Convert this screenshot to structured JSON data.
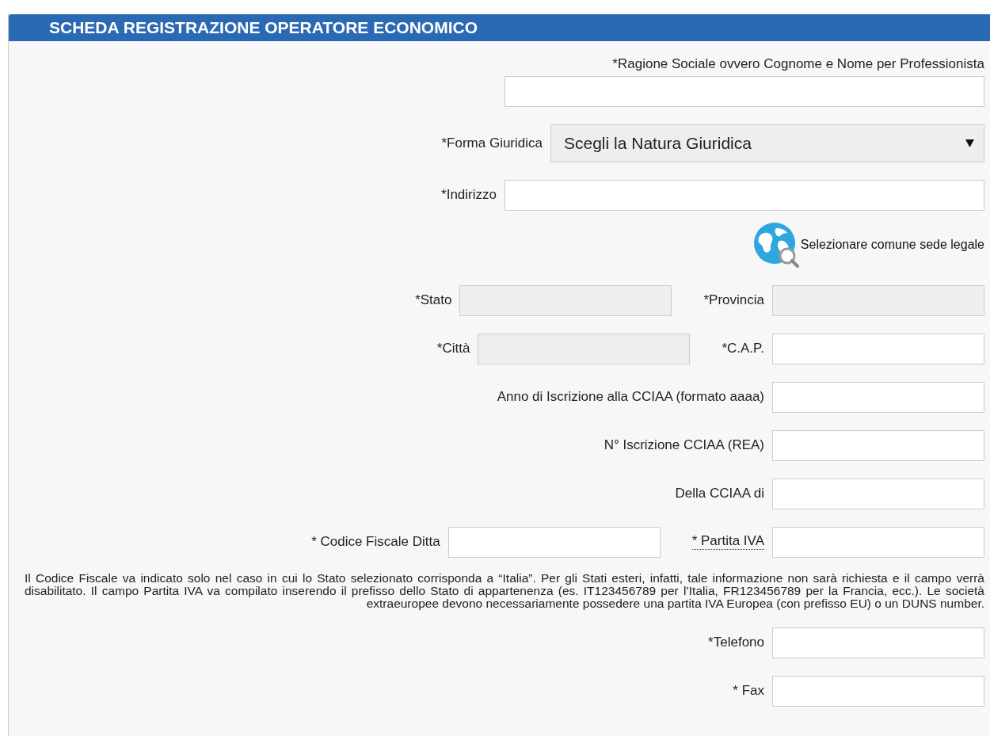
{
  "panel": {
    "title": "SCHEDA REGISTRAZIONE OPERATORE ECONOMICO"
  },
  "rows": [
    {
      "kind": "stacked",
      "fields": [
        {
          "label": "*Ragione Sociale ovvero Cognome e Nome per Professionista",
          "disabled": false
        }
      ]
    },
    {
      "kind": "select",
      "fields": [
        {
          "label": "*Forma Giuridica",
          "value": "Scegli la Natura Giuridica",
          "disabled": false
        }
      ]
    },
    {
      "kind": "wide",
      "fields": [
        {
          "label": "*Indirizzo",
          "disabled": false
        }
      ]
    },
    {
      "kind": "link",
      "text": "Selezionare comune sede legale"
    },
    {
      "kind": "pair",
      "fields": [
        {
          "label": "*Stato",
          "disabled": true
        },
        {
          "label": "*Provincia",
          "disabled": true
        }
      ]
    },
    {
      "kind": "pair",
      "fields": [
        {
          "label": "*Città",
          "disabled": true
        },
        {
          "label": "*C.A.P.",
          "disabled": false
        }
      ]
    },
    {
      "kind": "single",
      "fields": [
        {
          "label": "Anno di Iscrizione alla CCIAA (formato aaaa)",
          "disabled": false
        }
      ]
    },
    {
      "kind": "single",
      "fields": [
        {
          "label": "N° Iscrizione CCIAA (REA)",
          "disabled": false
        }
      ]
    },
    {
      "kind": "single",
      "fields": [
        {
          "label": "Della CCIAA di",
          "disabled": false
        }
      ]
    },
    {
      "kind": "pair",
      "fields": [
        {
          "label": "* Codice Fiscale Ditta",
          "disabled": false
        },
        {
          "label": "* Partita IVA",
          "disabled": false,
          "dotted": true
        }
      ]
    },
    {
      "kind": "note",
      "text": "Il Codice Fiscale va indicato solo nel caso in cui lo Stato selezionato corrisponda a “Italia”. Per gli Stati esteri, infatti, tale informazione non sarà richiesta e il campo verrà disabilitato. Il campo Partita IVA va compilato inserendo il prefisso dello Stato di appartenenza (es. IT123456789 per l’Italia, FR123456789 per la Francia, ecc.). Le società extraeuropee devono necessariamente possedere una partita IVA Europea (con prefisso EU) o un DUNS number."
    },
    {
      "kind": "single",
      "fields": [
        {
          "label": "*Telefono",
          "disabled": false
        }
      ]
    },
    {
      "kind": "single",
      "fields": [
        {
          "label": "* Fax",
          "disabled": false
        }
      ]
    }
  ]
}
